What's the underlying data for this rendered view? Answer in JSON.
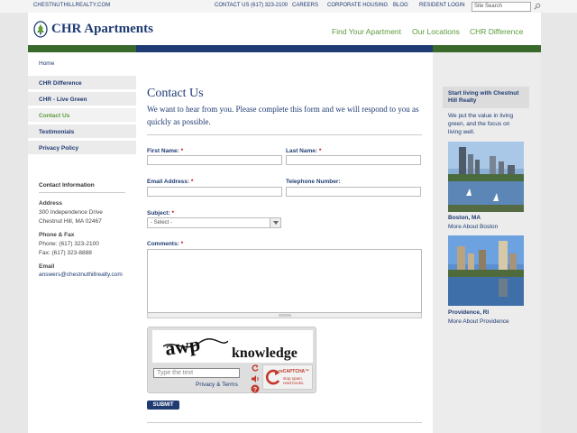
{
  "topbar": {
    "site_url": "CHESTNUTHILLREALTY.COM",
    "links": [
      "CONTACT US (617) 323-2100",
      "CAREERS",
      "CORPORATE HOUSING",
      "BLOG",
      "RESIDENT LOGIN"
    ],
    "search_placeholder": "Site Search"
  },
  "header": {
    "logo_text": "CHR Apartments",
    "nav": [
      "Find Your Apartment",
      "Our Locations",
      "CHR Difference"
    ]
  },
  "colors": {
    "navy": "#1f3b73",
    "green": "#5c9a3a",
    "required": "#cc0000"
  },
  "breadcrumb": "Home",
  "sidebar": {
    "items": [
      {
        "label": "CHR Difference",
        "active": false
      },
      {
        "label": "CHR - Live Green",
        "active": false
      },
      {
        "label": "Contact Us",
        "active": true
      },
      {
        "label": "Testimonials",
        "active": false
      },
      {
        "label": "Privacy Policy",
        "active": false
      }
    ],
    "contact": {
      "heading": "Contact Information",
      "address_label": "Address",
      "address_line1": "300 Independence Drive",
      "address_line2": "Chestnut Hill, MA 02467",
      "phone_label": "Phone & Fax",
      "phone": "Phone: (617) 323-2100",
      "fax": "Fax: (617) 323-8888",
      "email_label": "Email",
      "email": "answers@chestnuthillrealty.com"
    }
  },
  "main": {
    "title": "Contact Us",
    "intro": "We want to hear from you. Please complete this form and we will respond to you as quickly as possible.",
    "form": {
      "first_name": "First Name:",
      "last_name": "Last Name:",
      "email": "Email Address:",
      "telephone": "Telephone Number:",
      "subject": "Subject:",
      "subject_value": "- Select -",
      "comments": "Comments:",
      "required_mark": "*",
      "submit": "SUBMIT"
    },
    "captcha": {
      "word1": "awp",
      "word2": "knowledge",
      "input_placeholder": "Type the text",
      "privacy_terms": "Privacy & Terms",
      "brand": "reCAPTCHA™",
      "tagline": "stop spam. read books."
    }
  },
  "rightcol": {
    "box_title": "Start living with Chestnut Hill Realty",
    "text": "We put the value in living green, and the focus on living well.",
    "locations": [
      {
        "name": "Boston, MA",
        "link": "More About Boston"
      },
      {
        "name": "Providence, RI",
        "link": "More About Providence"
      }
    ]
  }
}
